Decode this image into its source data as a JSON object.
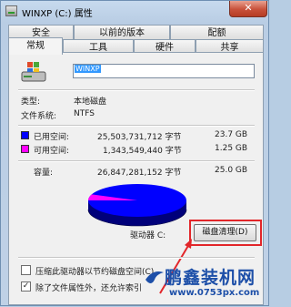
{
  "window": {
    "title": "WINXP (C:) 属性",
    "close_glyph": "✕"
  },
  "tabs_row1": [
    {
      "label": "安全"
    },
    {
      "label": "以前的版本"
    },
    {
      "label": "配额"
    }
  ],
  "tabs_row2": [
    {
      "label": "常规",
      "active": true
    },
    {
      "label": "工具"
    },
    {
      "label": "硬件"
    },
    {
      "label": "共享"
    }
  ],
  "general": {
    "volume_name": "WINXP",
    "type_label": "类型:",
    "type_value": "本地磁盘",
    "fs_label": "文件系统:",
    "fs_value": "NTFS",
    "used": {
      "label": "已用空间:",
      "bytes": "25,503,731,712 字节",
      "size": "23.7 GB",
      "color": "#0000ff"
    },
    "free": {
      "label": "可用空间:",
      "bytes": "1,343,549,440 字节",
      "size": "1.25 GB",
      "color": "#ff00ff"
    },
    "capacity": {
      "label": "容量:",
      "bytes": "26,847,281,152 字节",
      "size": "25.0 GB"
    },
    "drive_label": "驱动器 C:",
    "cleanup_button": "磁盘清理(D)",
    "compress_option": {
      "label": "压缩此驱动器以节约磁盘空间(C)",
      "checked": false
    },
    "index_option": {
      "label": "除了文件属性外，还允许索引",
      "checked": true
    }
  },
  "watermark": {
    "title": "鹏鑫装机网",
    "url": "www.0753px.com"
  }
}
